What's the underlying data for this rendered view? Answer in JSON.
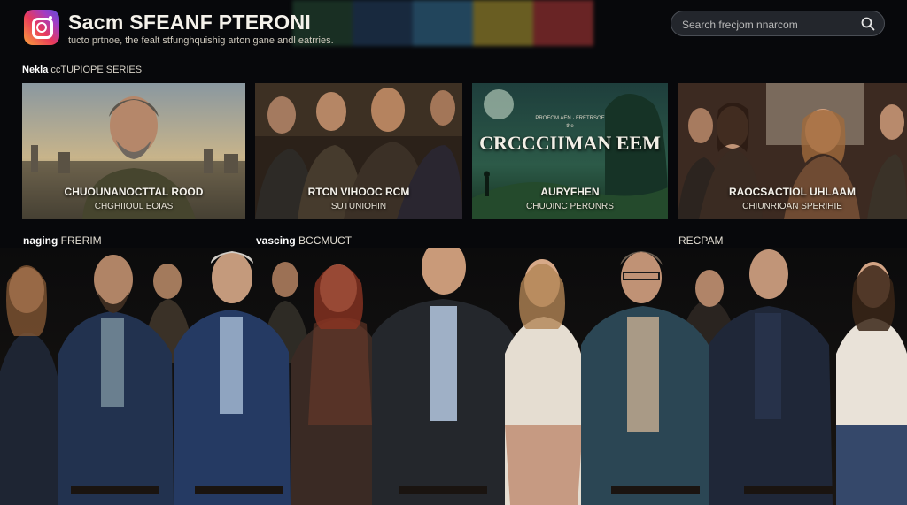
{
  "header": {
    "app_title": "Sacm SFEANF PTERONI",
    "tagline": "tucto prtnoe, the fealt stfunghquishig arton gane andl eatrries.",
    "logo_icon": "instagram-logo-icon",
    "brand_gradient": [
      "#f9a23a",
      "#e83a5c",
      "#a23cc4",
      "#5a4fd8"
    ],
    "top_stripe_colors": [
      "#1f3d2c",
      "#1e3550",
      "#2c5a78",
      "#8a7a2a",
      "#8a2e2e"
    ]
  },
  "search": {
    "placeholder": "Search frecjom nnarcom",
    "icon": "search-icon"
  },
  "section": {
    "title_bold": "Nekla",
    "title_rest": " ccTUPIOPE SERIES"
  },
  "cards": [
    {
      "big": "",
      "title": "CHUOUNANOCTTAL ROOD",
      "subtitle": "CHGHIIOUL EOIAS"
    },
    {
      "big": "",
      "title": "RTCN VIHOOC RCM",
      "subtitle": "SUTUNIOHIN"
    },
    {
      "big": "CRCCCIIMAN EEM",
      "kicker": "PROEOM AEN · FRETRSOE",
      "kicker2": "the",
      "title": "AURYFHEN",
      "subtitle": "CHUOINC PERONRS"
    },
    {
      "big": "",
      "title": "RAOCSACTIOL UHLAAM",
      "subtitle": "CHIUNRIOAN SPERIHIE"
    }
  ],
  "row_labels": [
    {
      "bold": "naging",
      "rest": " FRERIM"
    },
    {
      "bold": "vascing",
      "rest": " BCCMUCT"
    },
    {
      "bold": "",
      "rest": "RECPAM"
    }
  ],
  "colors": {
    "background": "#07080b",
    "text": "#e9e6df"
  }
}
